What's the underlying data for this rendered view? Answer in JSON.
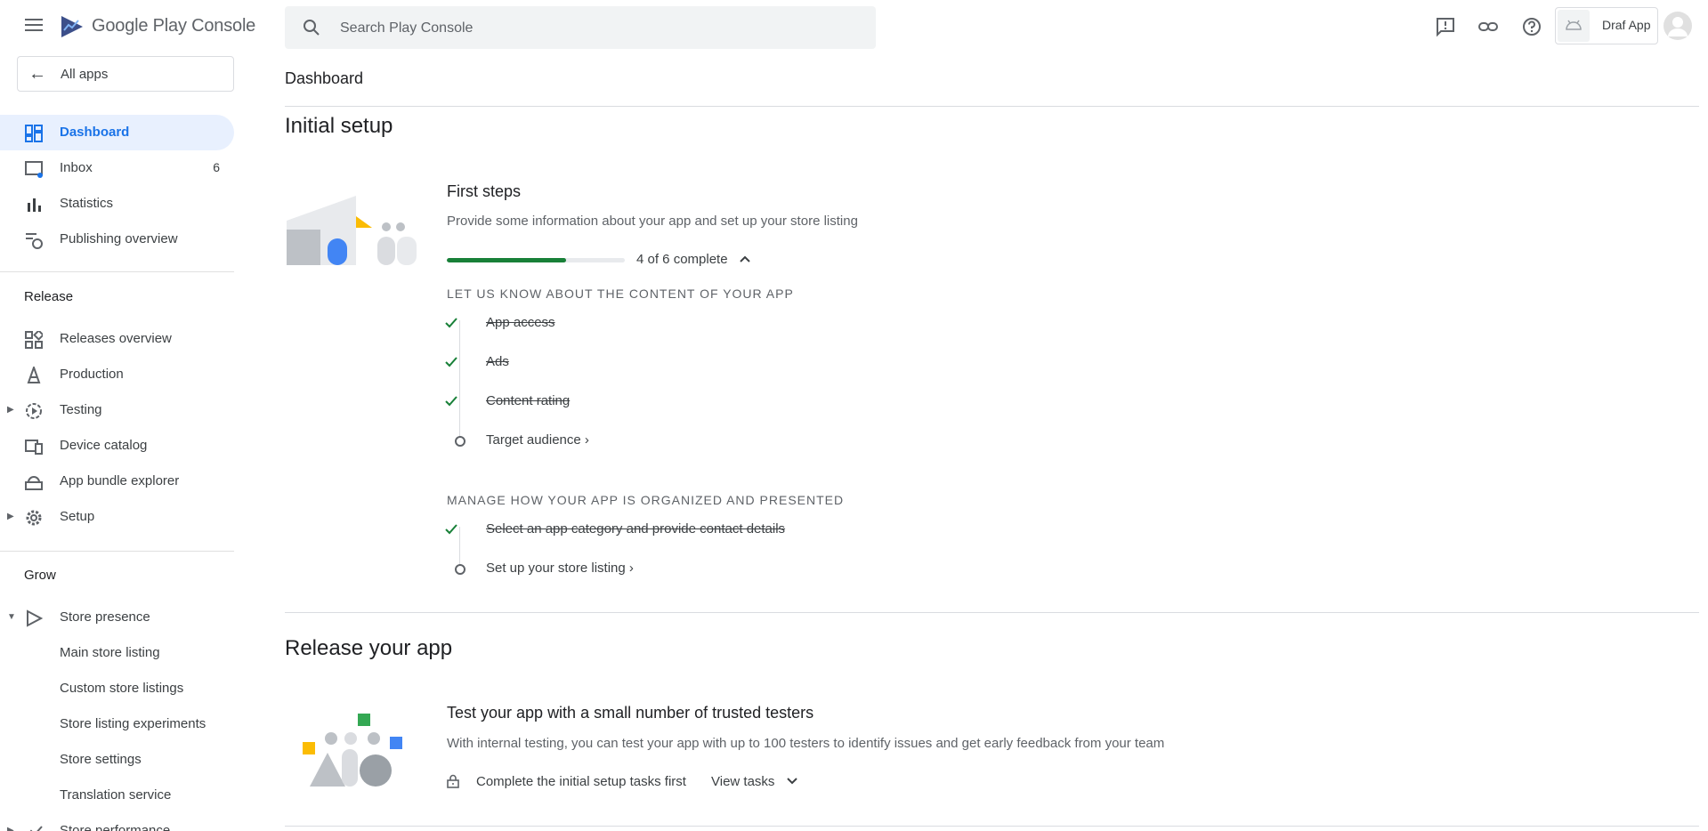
{
  "brand": {
    "name_google": "Google Play",
    "name_console": "Console"
  },
  "nav": {
    "all_apps": "All apps",
    "items": [
      {
        "label": "Dashboard",
        "icon": "dashboard-icon",
        "active": true
      },
      {
        "label": "Inbox",
        "icon": "inbox-icon",
        "badge": "6"
      },
      {
        "label": "Statistics",
        "icon": "bar-chart-icon"
      },
      {
        "label": "Publishing overview",
        "icon": "publishing-icon"
      }
    ],
    "release_title": "Release",
    "release_items": [
      {
        "label": "Releases overview",
        "icon": "releases-overview-icon"
      },
      {
        "label": "Production",
        "icon": "production-icon"
      },
      {
        "label": "Testing",
        "icon": "testing-icon"
      },
      {
        "label": "Device catalog",
        "icon": "device-catalog-icon"
      },
      {
        "label": "App bundle explorer",
        "icon": "bundle-explorer-icon"
      },
      {
        "label": "Setup",
        "icon": "gear-icon"
      }
    ],
    "grow_title": "Grow",
    "grow_items": [
      {
        "label": "Store presence",
        "icon": "play-icon"
      },
      {
        "label": "Main store listing"
      },
      {
        "label": "Custom store listings"
      },
      {
        "label": "Store listing experiments"
      },
      {
        "label": "Store settings"
      },
      {
        "label": "Translation service"
      },
      {
        "label": "Store performance"
      }
    ]
  },
  "header": {
    "search_placeholder": "Search Play Console",
    "app_name": "Draf App",
    "page_title": "Dashboard"
  },
  "main": {
    "initial_setup": {
      "title": "Initial setup",
      "card_title": "First steps",
      "card_desc": "Provide some information about your app and set up your store listing",
      "progress_fraction": 0.67,
      "progress_text": "4 of 6 complete",
      "group1_title": "LET US KNOW ABOUT THE CONTENT OF YOUR APP",
      "group1_tasks": [
        {
          "label": "App access",
          "done": true
        },
        {
          "label": "Ads",
          "done": true
        },
        {
          "label": "Content rating",
          "done": true
        },
        {
          "label": "Target audience",
          "done": false
        }
      ],
      "group2_title": "MANAGE HOW YOUR APP IS ORGANIZED AND PRESENTED",
      "group2_tasks": [
        {
          "label": "Select an app category and provide contact details",
          "done": true
        },
        {
          "label": "Set up your store listing",
          "done": false
        }
      ]
    },
    "release": {
      "title": "Release your app",
      "card_title": "Test your app with a small number of trusted testers",
      "card_desc": "With internal testing, you can test your app with up to 100 testers to identify issues and get early feedback from your team",
      "lock_text": "Complete the initial setup tasks first",
      "view_tasks": "View tasks"
    }
  },
  "colors": {
    "accent": "#1a73e8",
    "active_bg": "#e8f0fe",
    "success": "#188038"
  }
}
